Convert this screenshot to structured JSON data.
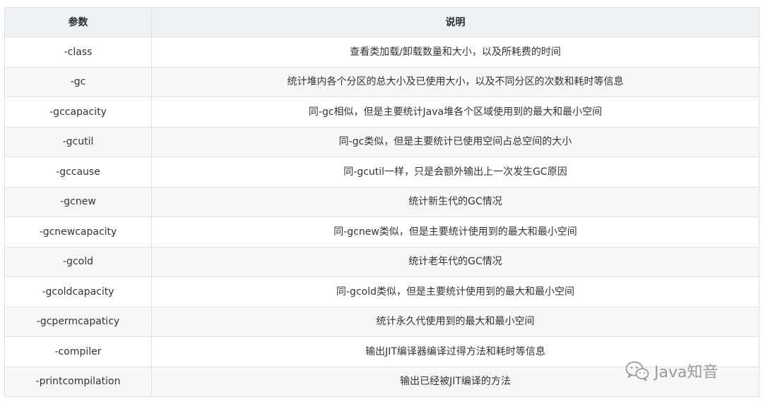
{
  "table": {
    "headers": [
      "参数",
      "说明"
    ],
    "rows": [
      {
        "param": "-class",
        "desc": "查看类加载/卸载数量和大小，以及所耗费的时间"
      },
      {
        "param": "-gc",
        "desc": "统计堆内各个分区的总大小及已使用大小，以及不同分区的次数和耗时等信息"
      },
      {
        "param": "-gccapacity",
        "desc": "同-gc相似，但是主要统计Java堆各个区域使用到的最大和最小空间"
      },
      {
        "param": "-gcutil",
        "desc": "同-gc类似，但是主要统计已使用空间占总空间的大小"
      },
      {
        "param": "-gccause",
        "desc": "同-gcutil一样，只是会额外输出上一次发生GC原因"
      },
      {
        "param": "-gcnew",
        "desc": "统计新生代的GC情况"
      },
      {
        "param": "-gcnewcapacity",
        "desc": "同-gcnew类似，但是主要统计使用到的最大和最小空间"
      },
      {
        "param": "-gcold",
        "desc": "统计老年代的GC情况"
      },
      {
        "param": "-gcoldcapacity",
        "desc": "同-gcold类似，但是主要统计使用到的最大和最小空间"
      },
      {
        "param": "-gcpermcapaticy",
        "desc": "统计永久代使用到的最大和最小空间"
      },
      {
        "param": "-compiler",
        "desc": "输出JIT编译器编译过得方法和耗时等信息"
      },
      {
        "param": "-printcompilation",
        "desc": "输出已经被JIT编译的方法"
      }
    ]
  },
  "watermark": {
    "text": "Java知音",
    "icon": "wechat-icon"
  },
  "colors": {
    "header_bg": "#eef2f7",
    "stripe_bg": "#f7f7f7",
    "border": "#dfe2e5",
    "text": "#333333"
  }
}
